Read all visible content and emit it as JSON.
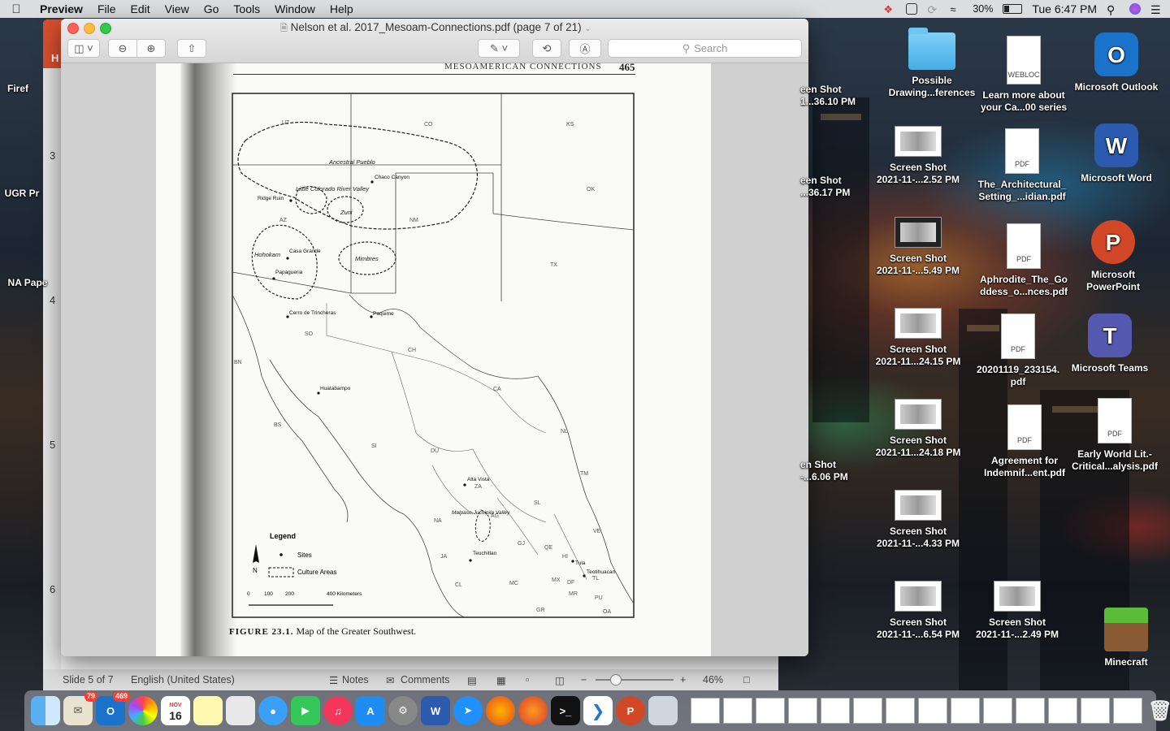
{
  "menubar": {
    "app": "Preview",
    "items": [
      "File",
      "Edit",
      "View",
      "Go",
      "Tools",
      "Window",
      "Help"
    ],
    "battery": "30%",
    "clock": "Tue 6:47 PM"
  },
  "preview": {
    "title": "Nelson et al. 2017_Mesoam-Connections.pdf (page 7 of 21)",
    "search_placeholder": "Search",
    "page": {
      "running_head": "MESOAMERICAN CONNECTIONS",
      "page_number": "465",
      "caption_label": "FIGURE 23.1.",
      "caption_text": "Map of the Greater Southwest."
    },
    "map": {
      "states_us": [
        "UT",
        "CO",
        "KS",
        "OK",
        "NM",
        "AZ",
        "TX"
      ],
      "states_mx": [
        "SO",
        "CH",
        "BN",
        "BS",
        "CA",
        "SI",
        "DU",
        "NL",
        "TM",
        "ZA",
        "SL",
        "NA",
        "AG",
        "JA",
        "GJ",
        "QE",
        "VE",
        "HI",
        "MC",
        "MX",
        "DF",
        "TL",
        "MR",
        "PU",
        "CL",
        "GR",
        "OA"
      ],
      "culture_areas": [
        "Ancestral Pueblo",
        "Little Colorado River Valley",
        "Zuni",
        "Hohokam",
        "Mimbres"
      ],
      "sites": [
        "Chaco Canyon",
        "Ridge Ruin",
        "Casa Grande",
        "Papagueria",
        "Cerro de Trincheras",
        "Paquime",
        "Huatabampo",
        "Alta Vista",
        "Malpaso-Juchipila Valley",
        "Teuchitlan",
        "Tula",
        "Teotihuacan"
      ],
      "legend_title": "Legend",
      "legend_sites": "Sites",
      "legend_areas": "Culture Areas",
      "scale": [
        "0",
        "100",
        "200",
        "400 Kilometers"
      ],
      "north": "N"
    }
  },
  "ppt": {
    "slide_numbers": [
      "3",
      "4",
      "5",
      "6"
    ],
    "status_slide": "Slide 5 of 7",
    "status_lang": "English (United States)",
    "notes": "Notes",
    "comments": "Comments",
    "zoom": "46%"
  },
  "desktop": {
    "left_labels": [
      "Firef",
      "UGR Pr",
      "NA Pape"
    ],
    "partial_shots": [
      {
        "line1": "een Shot",
        "line2": "1...36.10 PM"
      },
      {
        "line1": "een Shot",
        "line2": "...36.17 PM"
      },
      {
        "line1": "en Shot",
        "line2": "-...6.06 PM"
      }
    ],
    "icons": [
      {
        "name": "Possible Drawing...ferences",
        "line1": "Possible",
        "line2": "Drawing...ferences"
      },
      {
        "name": "weblock",
        "line1": "Learn more about",
        "line2": "your Ca...00 series",
        "badge": "WEBLOC"
      },
      {
        "name": "outlook",
        "line1": "Microsoft Outlook"
      },
      {
        "name": "shot1",
        "line1": "Screen Shot",
        "line2": "2021-11-...2.52 PM"
      },
      {
        "name": "arch",
        "line1": "The_Architectural_",
        "line2": "Setting_...idian.pdf",
        "badge": "PDF"
      },
      {
        "name": "word",
        "line1": "Microsoft Word"
      },
      {
        "name": "shot2",
        "line1": "Screen Shot",
        "line2": "2021-11-...5.49 PM"
      },
      {
        "name": "aphro",
        "line1": "Aphrodite_The_Go",
        "line2": "ddess_o...nces.pdf",
        "badge": "PDF"
      },
      {
        "name": "ppt",
        "line1": "Microsoft",
        "line2": "PowerPoint"
      },
      {
        "name": "shot3",
        "line1": "Screen Shot",
        "line2": "2021-11...24.15 PM"
      },
      {
        "name": "scan",
        "line1": "20201119_233154.",
        "line2": "pdf",
        "badge": "PDF"
      },
      {
        "name": "teams",
        "line1": "Microsoft Teams"
      },
      {
        "name": "shot4",
        "line1": "Screen Shot",
        "line2": "2021-11...24.18 PM"
      },
      {
        "name": "agree",
        "line1": "Agreement for",
        "line2": "Indemnif...ent.pdf",
        "badge": "PDF"
      },
      {
        "name": "early",
        "line1": "Early World Lit.-",
        "line2": "Critical...alysis.pdf",
        "badge": "PDF"
      },
      {
        "name": "shot5",
        "line1": "Screen Shot",
        "line2": "2021-11-...4.33 PM"
      },
      {
        "name": "shot6",
        "line1": "Screen Shot",
        "line2": "2021-11-...6.54 PM"
      },
      {
        "name": "shot7",
        "line1": "Screen Shot",
        "line2": "2021-11-...2.49 PM"
      },
      {
        "name": "minecraft",
        "line1": "Minecraft"
      }
    ]
  },
  "dock": {
    "mail_badge": "79",
    "outlook_badge": "469",
    "calendar_month": "NOV",
    "calendar_day": "16"
  }
}
